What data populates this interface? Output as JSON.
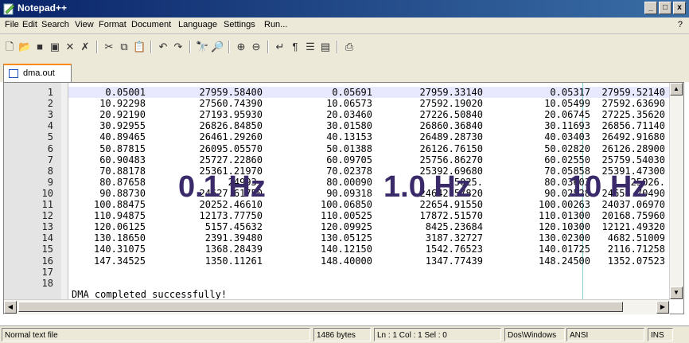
{
  "window": {
    "title": "Notepad++",
    "minimize": "_",
    "maximize": "□",
    "close": "x"
  },
  "menu": {
    "items": [
      "File",
      "Edit",
      "Search",
      "View",
      "Format",
      "Document",
      "Language",
      "Settings",
      "Run..."
    ],
    "help": "?"
  },
  "toolbar": {
    "icons": [
      "new-file-icon",
      "open-file-icon",
      "save-icon",
      "save-all-icon",
      "close-icon",
      "close-all-icon",
      "cut-icon",
      "copy-icon",
      "paste-icon",
      "undo-icon",
      "redo-icon",
      "find-icon",
      "replace-icon",
      "zoom-in-icon",
      "zoom-out-icon",
      "word-wrap-icon",
      "show-all-chars-icon",
      "indent-guide-icon",
      "user-lang-icon",
      "print-icon"
    ]
  },
  "tab": {
    "label": "dma.out"
  },
  "editor": {
    "line_numbers": [
      "1",
      "2",
      "3",
      "4",
      "5",
      "6",
      "7",
      "8",
      "9",
      "10",
      "11",
      "12",
      "13",
      "14",
      "15",
      "16",
      "17",
      "18"
    ],
    "rows": [
      [
        "0.05001",
        "27959.58400",
        "0.05691",
        "27959.33140",
        "0.05317",
        "27959.52140"
      ],
      [
        "10.92298",
        "27560.74390",
        "10.06573",
        "27592.19020",
        "10.05499",
        "27592.63690"
      ],
      [
        "20.92190",
        "27193.95930",
        "20.03460",
        "27226.50840",
        "20.06745",
        "27225.35620"
      ],
      [
        "30.92955",
        "26826.84850",
        "30.01580",
        "26860.36840",
        "30.11693",
        "26856.71140"
      ],
      [
        "40.89465",
        "26461.29260",
        "40.13153",
        "26489.28730",
        "40.03403",
        "26492.91680"
      ],
      [
        "50.87815",
        "26095.05570",
        "50.01388",
        "26126.76150",
        "50.02820",
        "26126.28900"
      ],
      [
        "60.90483",
        "25727.22860",
        "60.09705",
        "25756.86270",
        "60.02550",
        "25759.54030"
      ],
      [
        "70.88178",
        "25361.21970",
        "70.02378",
        "25392.69680",
        "70.05858",
        "25391.47300"
      ],
      [
        "80.87658",
        "24993.",
        "80.00090",
        "25025.",
        "80.03603",
        "25026."
      ],
      [
        "90.88730",
        "24627.61750",
        "90.09318",
        "24642.57820",
        "90.02528",
        "24658.70490"
      ],
      [
        "100.88475",
        "20252.46610",
        "100.06850",
        "22654.91550",
        "100.00263",
        "24037.06970"
      ],
      [
        "110.94875",
        "12173.77750",
        "110.00525",
        "17872.51570",
        "110.01300",
        "20168.75960"
      ],
      [
        "120.06125",
        "5157.45632",
        "120.09925",
        "8425.23684",
        "120.10300",
        "12121.49320"
      ],
      [
        "130.18650",
        "2391.39480",
        "130.05125",
        "3187.32727",
        "130.02300",
        "4682.51009"
      ],
      [
        "140.31075",
        "1368.28439",
        "140.12150",
        "1542.76523",
        "140.01725",
        "2116.71258"
      ],
      [
        "147.34525",
        "1350.11261",
        "148.40000",
        "1347.77439",
        "148.24500",
        "1352.07523"
      ]
    ],
    "message": "DMA completed successfully!"
  },
  "overlays": [
    "0.1 Hz",
    "1.0 Hz",
    "10 Hz"
  ],
  "status": {
    "file_type": "Normal text file",
    "size": "1486 bytes",
    "position": "Ln : 1   Col : 1   Sel : 0",
    "eol": "Dos\\Windows",
    "encoding": "ANSI",
    "mode": "INS"
  },
  "colors": {
    "overlay": "#3a2a6a",
    "current_line": "#e8e8ff",
    "title_bar": "#0a246a"
  }
}
